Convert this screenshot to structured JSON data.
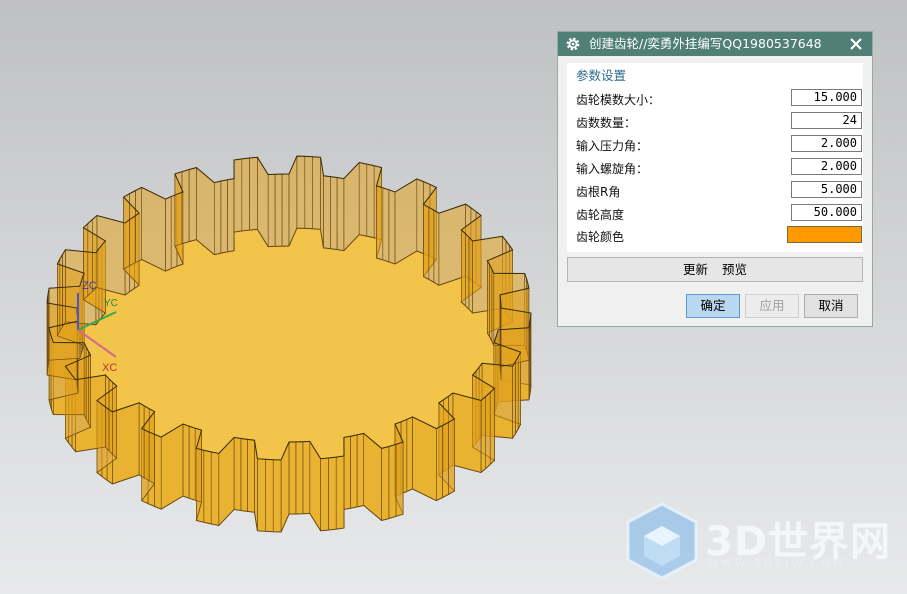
{
  "dialog": {
    "title": "创建齿轮//奕勇外挂编写QQ1980537648",
    "group_title": "参数设置",
    "fields": [
      {
        "label": "齿轮模数大小：",
        "value": "15.000"
      },
      {
        "label": "齿数数量：",
        "value": "24"
      },
      {
        "label": "输入压力角：",
        "value": "2.000"
      },
      {
        "label": "输入螺旋角：",
        "value": "2.000"
      },
      {
        "label": "齿根R角",
        "value": "5.000"
      },
      {
        "label": "齿轮高度",
        "value": "50.000"
      }
    ],
    "color_field": {
      "label": "齿轮颜色",
      "color": "#ff9a00"
    },
    "update_label": "更新",
    "preview_label": "预览",
    "ok_label": "确定",
    "apply_label": "应用",
    "cancel_label": "取消",
    "icons": {
      "settings": "gear-icon",
      "close": "close-icon"
    }
  },
  "triad": {
    "z_label": "ZC",
    "y_label": "YC",
    "x_label": "XC"
  },
  "watermark": {
    "brand": "3D世界网",
    "url": "WWW.3DSJW.COM"
  },
  "model": {
    "tooth_count": 24,
    "fill_color": "#f4c23a",
    "wall_color": "#e2a21e"
  }
}
